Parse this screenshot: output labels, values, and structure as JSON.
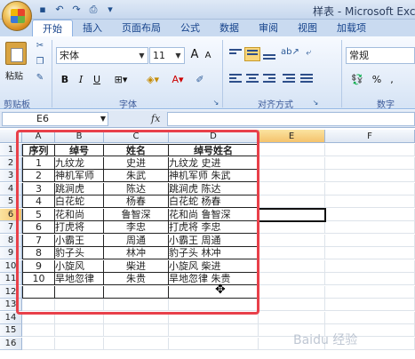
{
  "window": {
    "title": "样表 - Microsoft Excel"
  },
  "qat": {
    "save_icon": "save-icon",
    "undo_icon": "undo-icon",
    "redo_icon": "redo-icon",
    "preview_icon": "print-preview-icon"
  },
  "ribbon_tabs": [
    "开始",
    "插入",
    "页面布局",
    "公式",
    "数据",
    "审阅",
    "视图",
    "加载项"
  ],
  "clipboard": {
    "paste_label": "粘贴",
    "group_label": "剪贴板"
  },
  "font": {
    "name": "宋体",
    "size": "11",
    "group_label": "字体",
    "bold": "B",
    "italic": "I",
    "underline": "U",
    "grow": "A",
    "shrink": "A"
  },
  "alignment": {
    "group_label": "对齐方式"
  },
  "number": {
    "format": "常规",
    "group_label": "数字",
    "percent": "%"
  },
  "formula_bar": {
    "name_box": "E6",
    "fx": "fx",
    "content": ""
  },
  "columns": [
    "A",
    "B",
    "C",
    "D",
    "E",
    "F"
  ],
  "rows": [
    "1",
    "2",
    "3",
    "4",
    "5",
    "6",
    "7",
    "8",
    "9",
    "10",
    "11",
    "12",
    "13",
    "14",
    "15",
    "16"
  ],
  "table": {
    "header": [
      "序列",
      "绰号",
      "姓名",
      "绰号姓名"
    ],
    "rows": [
      [
        "1",
        "九纹龙",
        "史进",
        "九纹龙  史进"
      ],
      [
        "2",
        "神机军师",
        "朱武",
        "神机军师  朱武"
      ],
      [
        "3",
        "跳涧虎",
        "陈达",
        "跳涧虎  陈达"
      ],
      [
        "4",
        "白花蛇",
        "杨春",
        "白花蛇  杨春"
      ],
      [
        "5",
        "花和尚",
        "鲁智深",
        "花和尚   鲁智深"
      ],
      [
        "6",
        "打虎将",
        "李忠",
        "打虎将  李忠"
      ],
      [
        "7",
        " 小霸王",
        "周通",
        "  小霸王  周通"
      ],
      [
        "8",
        "豹子头",
        "林冲",
        "豹子头  林冲"
      ],
      [
        "9",
        "小旋风",
        "柴进",
        "小旋风  柴进"
      ],
      [
        "10",
        "旱地忽律",
        "朱贵",
        "旱地忽律  朱贵"
      ]
    ]
  },
  "watermark": "Baidu 经验"
}
